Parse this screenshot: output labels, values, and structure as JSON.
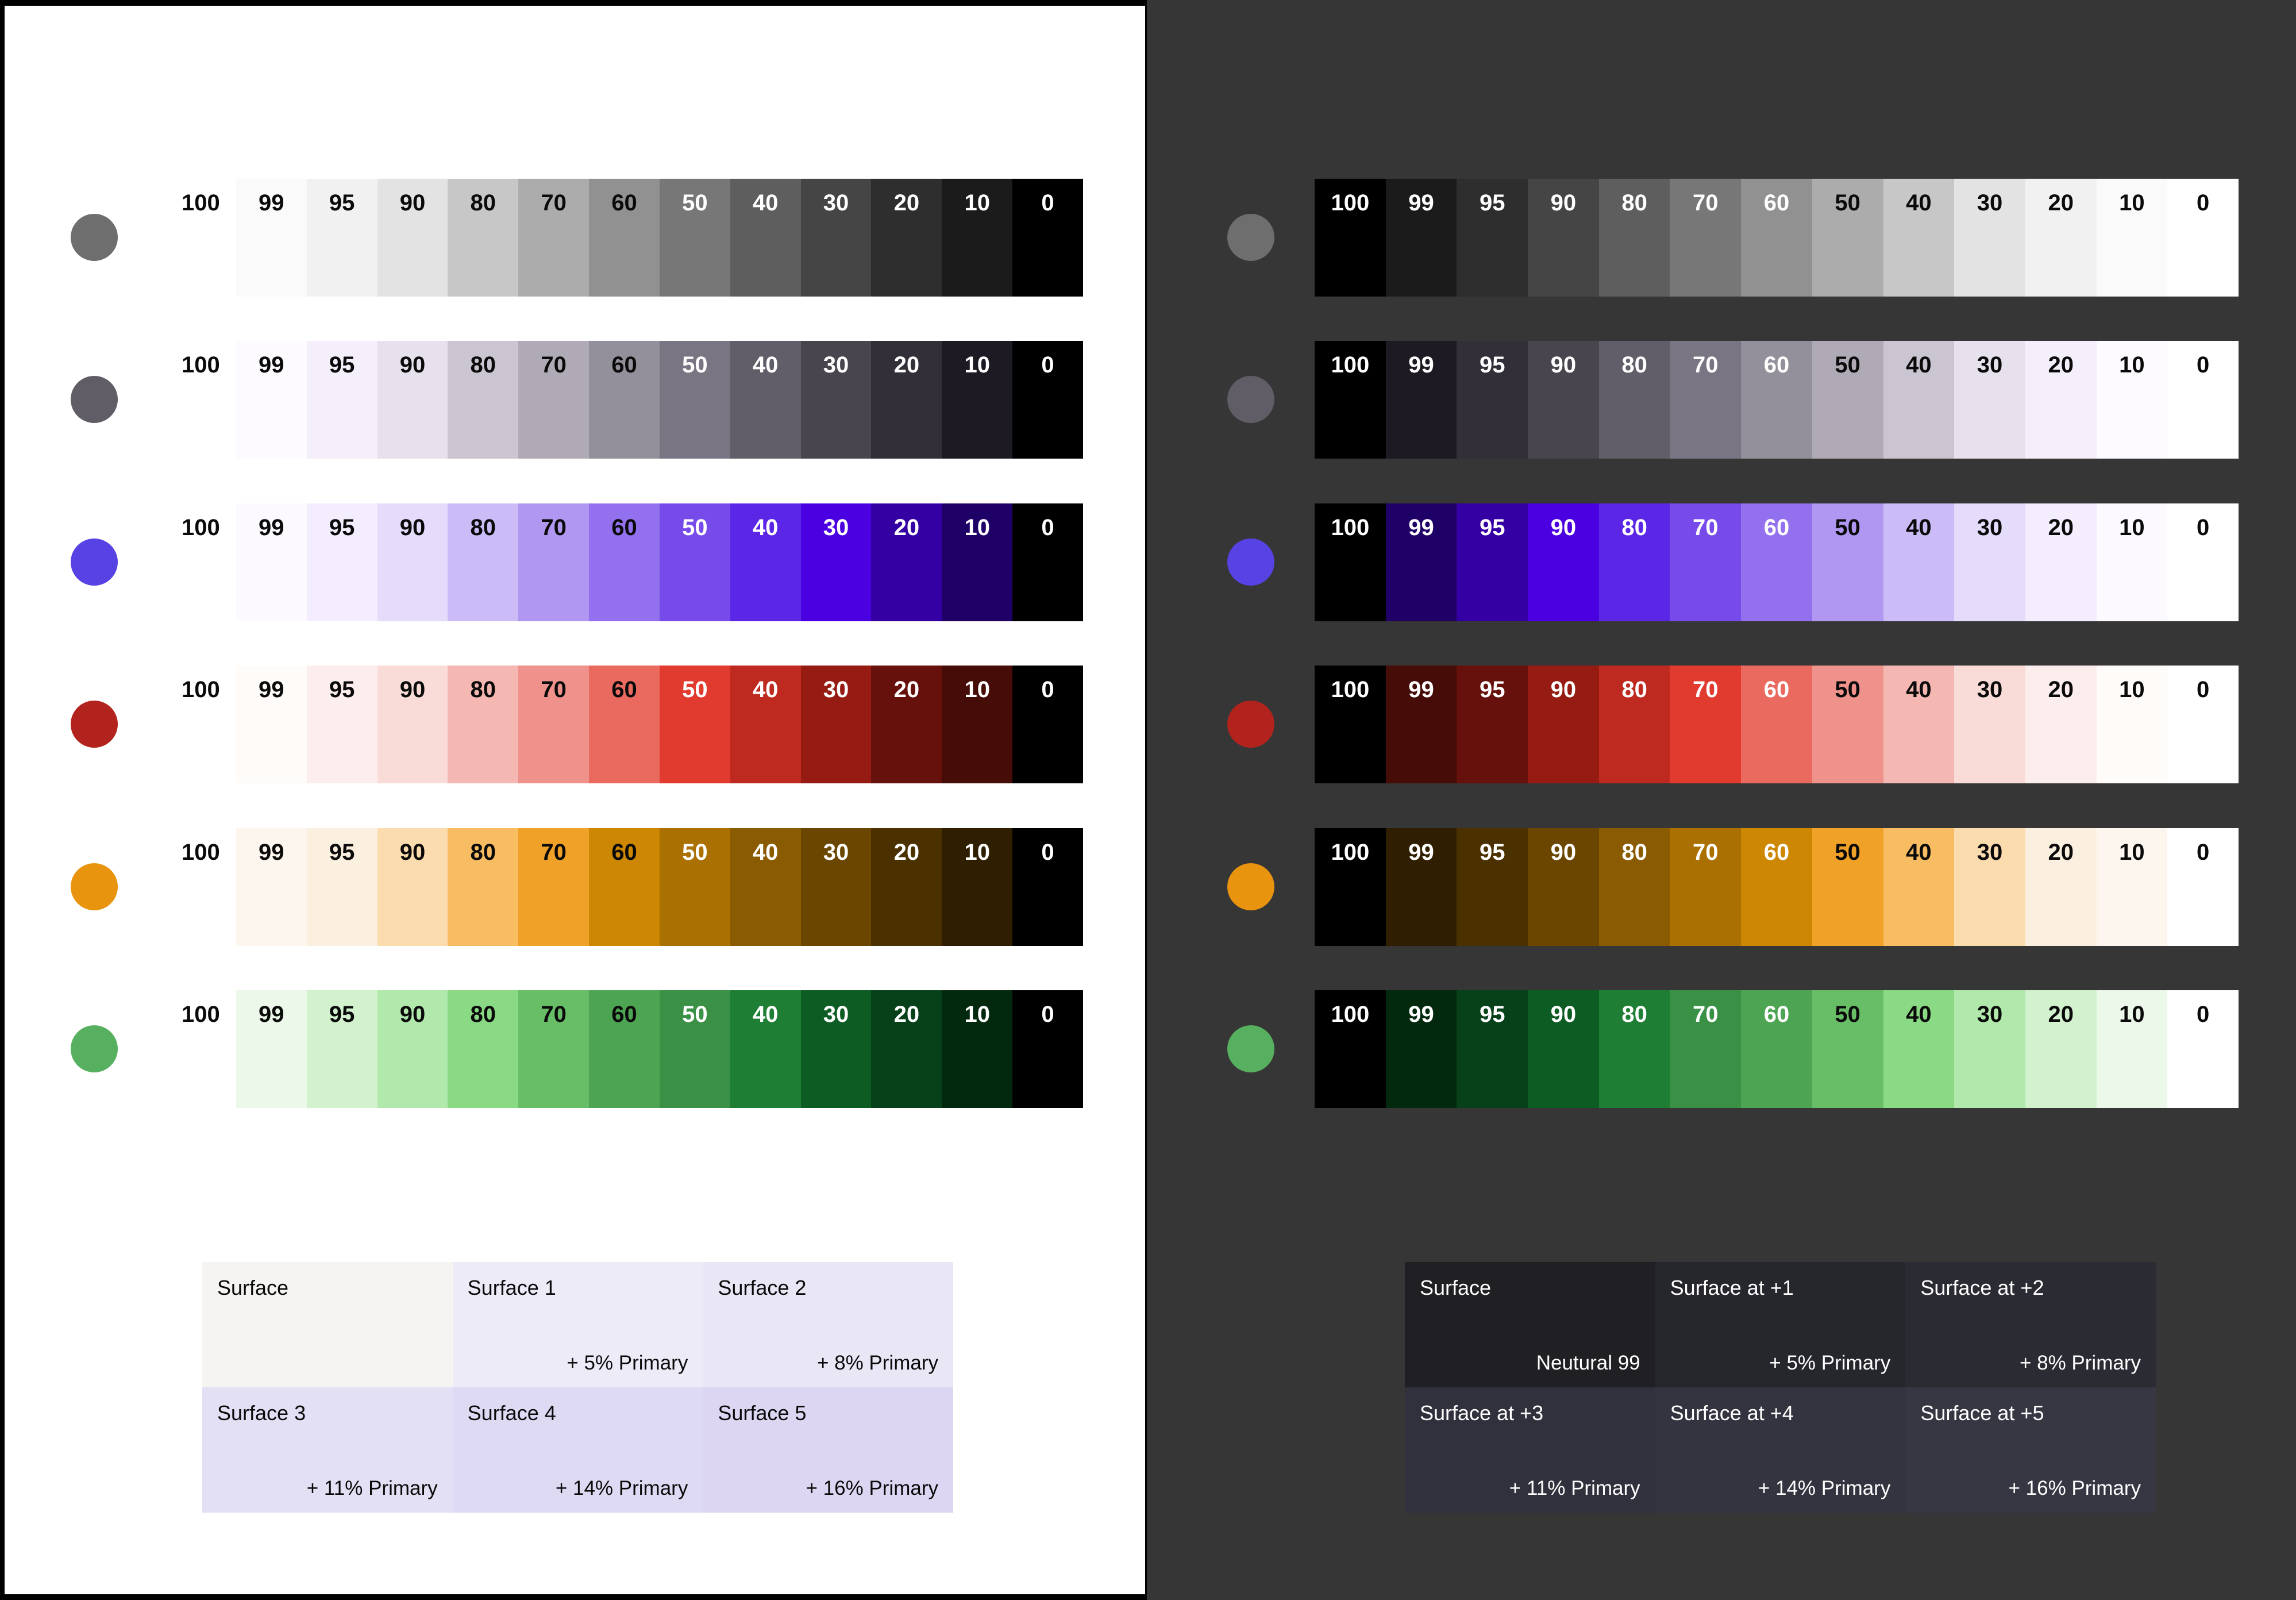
{
  "canvas": {
    "bg": "#000000"
  },
  "panels": {
    "light": {
      "bg": "#FFFFFF",
      "text": "#0A0A0A"
    },
    "dark": {
      "bg": "#363636",
      "text": "#FFFFFF"
    }
  },
  "tone_labels": [
    "100",
    "99",
    "95",
    "90",
    "80",
    "70",
    "60",
    "50",
    "40",
    "30",
    "20",
    "10",
    "0"
  ],
  "palettes": [
    {
      "name": "neutral",
      "dot": "#6E6E6E",
      "tones": [
        "#FFFFFF",
        "#FAFAFA",
        "#F1F1F1",
        "#E3E3E3",
        "#C7C7C7",
        "#ACACAC",
        "#919191",
        "#777777",
        "#5E5E5E",
        "#454545",
        "#2E2E2E",
        "#1B1B1B",
        "#000000"
      ]
    },
    {
      "name": "neutral-variant",
      "dot": "#605D66",
      "tones": [
        "#FFFFFF",
        "#FDFBFF",
        "#F4EFFA",
        "#E6E1EC",
        "#CAC5D1",
        "#AFAAB6",
        "#94909B",
        "#7A7582",
        "#615D69",
        "#49454F",
        "#322F38",
        "#1D1A23",
        "#000000"
      ]
    },
    {
      "name": "primary-purple",
      "dot": "#5742E3",
      "tones": [
        "#FFFFFF",
        "#FDFAFF",
        "#F3EDFE",
        "#E5DBFB",
        "#CBBBF7",
        "#AF97F2",
        "#9371EE",
        "#774AEA",
        "#5C26E7",
        "#4A00E0",
        "#3400A3",
        "#1F0066",
        "#000000"
      ]
    },
    {
      "name": "red",
      "dot": "#B2231D",
      "tones": [
        "#FFFFFF",
        "#FFFBF9",
        "#FCEEEC",
        "#F9DCD8",
        "#F4B7B1",
        "#EF928B",
        "#EA6A60",
        "#E13A2E",
        "#BE2A1F",
        "#951B13",
        "#67110C",
        "#450C08",
        "#000000"
      ]
    },
    {
      "name": "orange",
      "dot": "#E9940E",
      "tones": [
        "#FFFFFF",
        "#FDF6EE",
        "#FBEFDF",
        "#FBDCAE",
        "#F8BD62",
        "#F0A127",
        "#CD8703",
        "#AA7002",
        "#8A5B00",
        "#6A4600",
        "#4C3100",
        "#2F1F00",
        "#000000"
      ]
    },
    {
      "name": "green",
      "dot": "#57B05F",
      "tones": [
        "#FFFFFF",
        "#ECF8EA",
        "#D2F2CE",
        "#B0E9AB",
        "#8AD984",
        "#67BE66",
        "#4DA453",
        "#3A9146",
        "#1E7E33",
        "#0D5C23",
        "#064119",
        "#02290E",
        "#000000"
      ]
    }
  ],
  "light_surfaces": [
    {
      "title": "Surface",
      "note": "",
      "bg": "#F5F4F2"
    },
    {
      "title": "Surface 1",
      "note": "+ 5% Primary",
      "bg": "#EDEBF8"
    },
    {
      "title": "Surface 2",
      "note": "+ 8% Primary",
      "bg": "#E9E6F6"
    },
    {
      "title": "Surface 3",
      "note": "+ 11% Primary",
      "bg": "#E3DFF4"
    },
    {
      "title": "Surface 4",
      "note": "+ 14% Primary",
      "bg": "#DFDAF3"
    },
    {
      "title": "Surface 5",
      "note": "+ 16% Primary",
      "bg": "#DCD6F2"
    }
  ],
  "dark_surfaces": [
    {
      "title": "Surface",
      "note": "Neutural 99",
      "bg": "#1F1F24"
    },
    {
      "title": "Surface at +1",
      "note": "+ 5% Primary",
      "bg": "#26262D"
    },
    {
      "title": "Surface at +2",
      "note": "+ 8% Primary",
      "bg": "#2B2B33"
    },
    {
      "title": "Surface at +3",
      "note": "+ 11% Primary",
      "bg": "#31313D"
    },
    {
      "title": "Surface at +4",
      "note": "+ 14% Primary",
      "bg": "#343440"
    },
    {
      "title": "Surface at +5",
      "note": "+ 16% Primary",
      "bg": "#373744"
    }
  ]
}
